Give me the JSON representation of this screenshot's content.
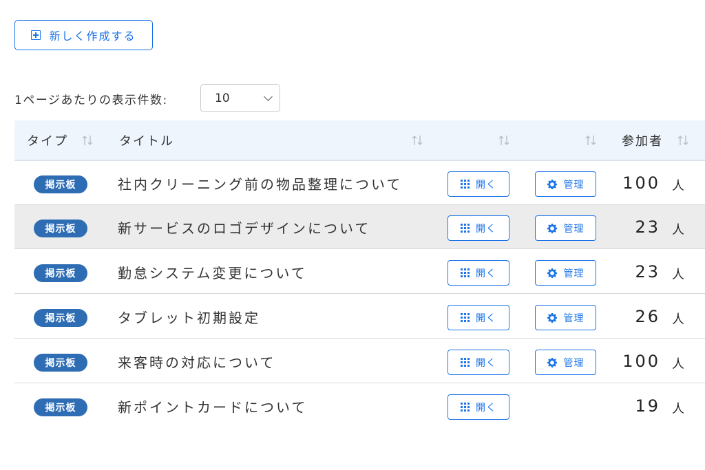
{
  "toolbar": {
    "create_label": "新しく作成する"
  },
  "pagination": {
    "per_page_label": "1ページあたりの表示件数:",
    "per_page_value": "10"
  },
  "table": {
    "headers": {
      "type": "タイプ",
      "title": "タイトル",
      "col3": "",
      "col4": "",
      "participants": "参加者"
    },
    "rows": [
      {
        "type": "掲示板",
        "title": "社内クリーニング前の物品整理について",
        "open": "開く",
        "manage": "管理",
        "count": "100",
        "unit": "人"
      },
      {
        "type": "掲示板",
        "title": "新サービスのロゴデザインについて",
        "open": "開く",
        "manage": "管理",
        "count": "23",
        "unit": "人"
      },
      {
        "type": "掲示板",
        "title": "勤怠システム変更について",
        "open": "開く",
        "manage": "管理",
        "count": "23",
        "unit": "人"
      },
      {
        "type": "掲示板",
        "title": "タブレット初期設定",
        "open": "開く",
        "manage": "管理",
        "count": "26",
        "unit": "人"
      },
      {
        "type": "掲示板",
        "title": "来客時の対応について",
        "open": "開く",
        "manage": "管理",
        "count": "100",
        "unit": "人"
      },
      {
        "type": "掲示板",
        "title": "新ポイントカードについて",
        "open": "開く",
        "count": "19",
        "unit": "人"
      }
    ]
  },
  "icons": {
    "create": "plus-square-icon",
    "sort": "sort-arrows-icon",
    "open": "grid-icon",
    "manage": "gear-icon",
    "select": "chevron-down-icon"
  },
  "colors": {
    "accent": "#1a73e8",
    "badge": "#2e6db4",
    "header_bg": "#eef5fd",
    "row_alt": "#ececec"
  }
}
